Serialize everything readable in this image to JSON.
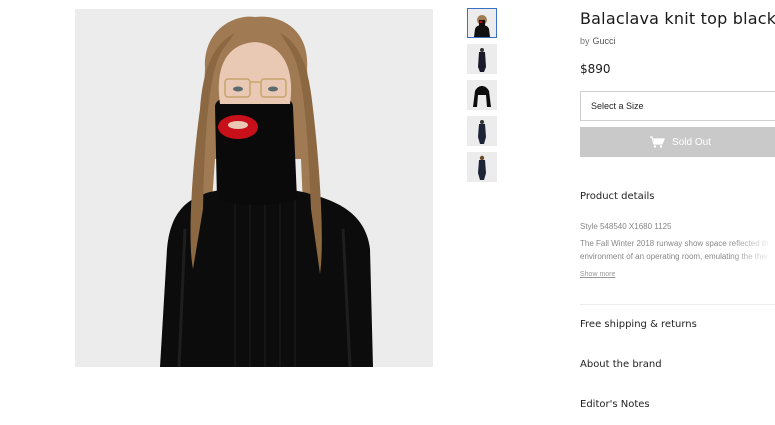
{
  "product": {
    "title": "Balaclava knit top black",
    "by_label": "by",
    "brand": "Gucci",
    "price": "$890"
  },
  "size_select": {
    "placeholder": "Select a Size"
  },
  "sold_out_button": {
    "label": "Sold Out",
    "icon": "shopping-bag-icon"
  },
  "product_details": {
    "heading": "Product details",
    "style": "Style 548540 X1680 1125",
    "description_lines": [
      "The Fall Winter 2018 runway show space reflected th",
      "environment of an operating room, emulating the ther"
    ],
    "show_more": "Show more"
  },
  "sections": {
    "shipping": "Free shipping & returns",
    "about": "About the brand",
    "editor": "Editor's Notes"
  },
  "gallery": {
    "thumbnail_count": 5,
    "active_index": 0
  },
  "colors": {
    "sold_out_bg": "#c9c9c9",
    "image_bg": "#ececec",
    "active_thumb_border": "#3b6fc4"
  }
}
